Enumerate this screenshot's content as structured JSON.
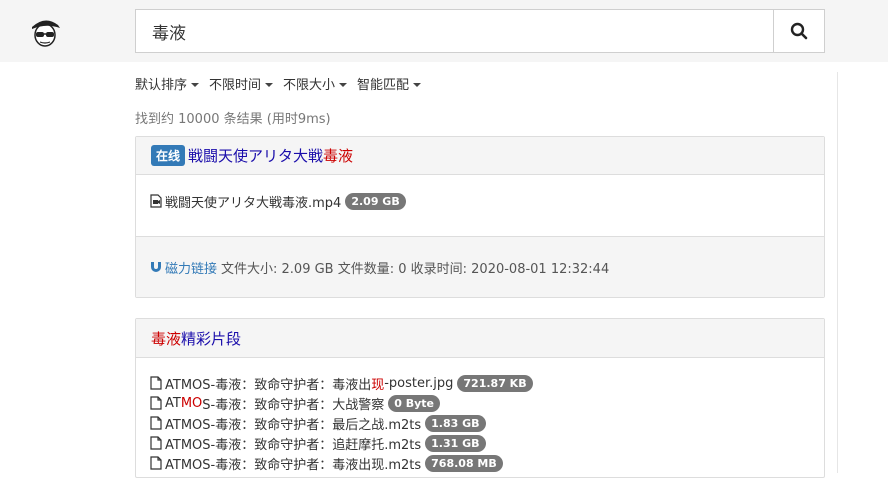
{
  "search": {
    "value": "毒液"
  },
  "filters": [
    {
      "label": "默认排序"
    },
    {
      "label": "不限时间"
    },
    {
      "label": "不限大小"
    },
    {
      "label": "智能匹配"
    }
  ],
  "stats": "找到约 10000 条结果 (用时9ms)",
  "results": [
    {
      "badge": "在线",
      "title_pre": "戦闘天使アリタ大戦",
      "title_hl": "毒液",
      "files": [
        {
          "name": "戦闘天使アリタ大戦毒液.mp4",
          "size": "2.09 GB"
        }
      ],
      "magnet_label": "磁力链接",
      "meta": "文件大小: 2.09 GB 文件数量: 0 收录时间: 2020-08-01 12:32:44"
    },
    {
      "title_hl": "毒液",
      "title_post": "精彩片段",
      "files": [
        {
          "name_parts": [
            "ATMOS-毒液：致命守护者：毒液出",
            "现",
            "-poster.jpg"
          ],
          "size": "721.87 KB"
        },
        {
          "name_parts": [
            "AT",
            "MO",
            "S-毒液：致命守护者：大战警察"
          ],
          "size": "0 Byte"
        },
        {
          "name_parts": [
            "ATMOS-毒液：致命守护者：最后之战.m2ts"
          ],
          "size": "1.83 GB"
        },
        {
          "name_parts": [
            "ATMOS-毒液：致命守护者：追赶摩托.m2ts"
          ],
          "size": "1.31 GB"
        },
        {
          "name_parts": [
            "ATMOS-毒液：致命守护者：毒液出现.m2ts"
          ],
          "size": "768.08 MB"
        }
      ]
    }
  ],
  "colors": {
    "highlight": "#cc0000",
    "title": "#1a0dab",
    "badge": "#337ab7",
    "size_badge": "#777777"
  },
  "icons": [
    "logo-avatar",
    "search-icon",
    "caret-down-icon",
    "video-file-icon",
    "file-icon",
    "magnet-icon"
  ]
}
